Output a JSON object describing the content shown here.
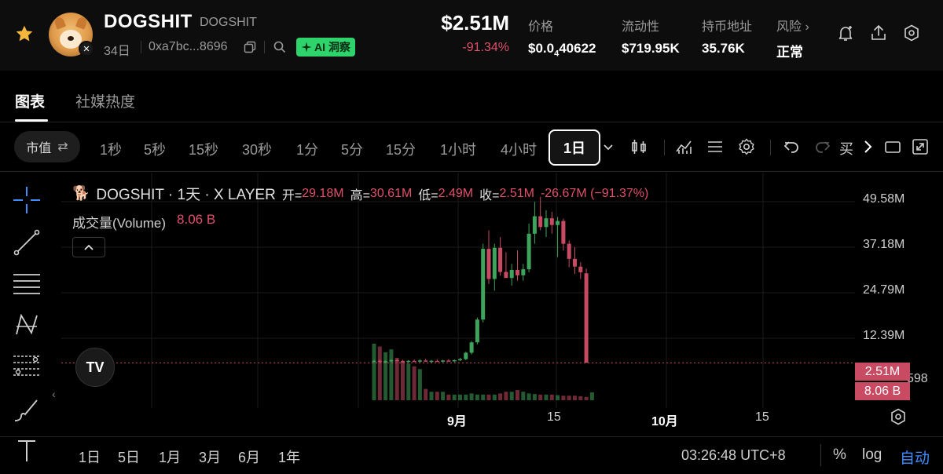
{
  "header": {
    "token_name": "DOGSHIT",
    "token_symbol": "DOGSHIT",
    "age": "34日",
    "address": "0xa7bc...8696",
    "ai_label": "AI 洞察",
    "market_cap": "$2.51M",
    "market_cap_change": "-91.34%",
    "stats": [
      {
        "label": "价格",
        "value_prefix": "$0.0",
        "value_sub": "4",
        "value_suffix": "40622"
      },
      {
        "label": "流动性",
        "value": "$719.95K"
      },
      {
        "label": "持币地址",
        "value": "35.76K"
      },
      {
        "label": "风险",
        "value": "正常"
      }
    ]
  },
  "tabs": [
    "图表",
    "社媒热度"
  ],
  "toolbar": {
    "mode_label": "市值",
    "intervals": [
      "1秒",
      "5秒",
      "15秒",
      "30秒",
      "1分",
      "5分",
      "15分",
      "1小时",
      "4小时"
    ],
    "active_interval": "1日",
    "buy_label": "买"
  },
  "legend": {
    "title": "DOGSHIT · 1天 · X LAYER",
    "open_label": "开=",
    "open": "29.18M",
    "high_label": "高=",
    "high": "30.61M",
    "low_label": "低=",
    "low": "2.49M",
    "close_label": "收=",
    "close": "2.51M",
    "change": "-26.67M (−91.37%)",
    "volume_label": "成交量(Volume)",
    "volume": "8.06 B"
  },
  "chart_data": {
    "type": "candlestick",
    "y_ticks": [
      "49.58M",
      "37.18M",
      "24.79M",
      "12.39M"
    ],
    "x_ticks": [
      "9月",
      "15",
      "10月",
      "15"
    ],
    "last_price_label": "2.51M",
    "last_volume_label": "8.06 B",
    "axis_peek": "598",
    "candles": [
      {
        "o": 2.9,
        "h": 3.4,
        "l": 2.5,
        "c": 3.1
      },
      {
        "o": 3.1,
        "h": 3.5,
        "l": 2.6,
        "c": 2.8
      },
      {
        "o": 2.8,
        "h": 3.2,
        "l": 2.4,
        "c": 3.0
      },
      {
        "o": 3.0,
        "h": 3.6,
        "l": 2.7,
        "c": 3.3
      },
      {
        "o": 3.3,
        "h": 3.7,
        "l": 2.9,
        "c": 3.0
      },
      {
        "o": 3.0,
        "h": 3.4,
        "l": 2.6,
        "c": 2.9
      },
      {
        "o": 2.9,
        "h": 3.3,
        "l": 2.5,
        "c": 3.1
      },
      {
        "o": 3.1,
        "h": 3.5,
        "l": 2.7,
        "c": 2.9
      },
      {
        "o": 2.9,
        "h": 3.6,
        "l": 2.6,
        "c": 3.2
      },
      {
        "o": 3.2,
        "h": 3.7,
        "l": 2.8,
        "c": 3.0
      },
      {
        "o": 3.0,
        "h": 3.4,
        "l": 2.6,
        "c": 3.1
      },
      {
        "o": 3.1,
        "h": 3.5,
        "l": 2.8,
        "c": 3.0
      },
      {
        "o": 3.0,
        "h": 3.4,
        "l": 2.7,
        "c": 3.2
      },
      {
        "o": 3.2,
        "h": 3.6,
        "l": 2.9,
        "c": 3.0
      },
      {
        "o": 3.0,
        "h": 3.5,
        "l": 2.7,
        "c": 3.3
      },
      {
        "o": 3.3,
        "h": 4.0,
        "l": 3.0,
        "c": 3.6
      },
      {
        "o": 3.6,
        "h": 5.8,
        "l": 3.3,
        "c": 5.5
      },
      {
        "o": 5.5,
        "h": 9.0,
        "l": 5.0,
        "c": 8.6
      },
      {
        "o": 8.6,
        "h": 16.0,
        "l": 8.0,
        "c": 15.4
      },
      {
        "o": 15.4,
        "h": 38.0,
        "l": 14.5,
        "c": 36.5
      },
      {
        "o": 36.5,
        "h": 42.0,
        "l": 26.0,
        "c": 27.5
      },
      {
        "o": 27.5,
        "h": 38.0,
        "l": 24.0,
        "c": 36.8
      },
      {
        "o": 36.8,
        "h": 40.0,
        "l": 28.5,
        "c": 29.6
      },
      {
        "o": 29.6,
        "h": 35.5,
        "l": 28.0,
        "c": 27.8
      },
      {
        "o": 27.8,
        "h": 32.0,
        "l": 25.5,
        "c": 30.2
      },
      {
        "o": 30.2,
        "h": 36.0,
        "l": 27.0,
        "c": 28.6
      },
      {
        "o": 28.6,
        "h": 32.0,
        "l": 27.0,
        "c": 30.4
      },
      {
        "o": 30.4,
        "h": 44.0,
        "l": 29.5,
        "c": 41.0
      },
      {
        "o": 41.0,
        "h": 50.5,
        "l": 38.0,
        "c": 46.2
      },
      {
        "o": 46.2,
        "h": 52.0,
        "l": 42.0,
        "c": 43.0
      },
      {
        "o": 43.0,
        "h": 48.0,
        "l": 40.0,
        "c": 45.6
      },
      {
        "o": 45.6,
        "h": 47.5,
        "l": 41.0,
        "c": 43.6
      },
      {
        "o": 43.6,
        "h": 46.0,
        "l": 34.0,
        "c": 44.8
      },
      {
        "o": 44.8,
        "h": 45.5,
        "l": 36.0,
        "c": 38.0
      },
      {
        "o": 38.0,
        "h": 39.0,
        "l": 31.0,
        "c": 33.5
      },
      {
        "o": 33.5,
        "h": 37.0,
        "l": 29.0,
        "c": 31.2
      },
      {
        "o": 31.2,
        "h": 32.5,
        "l": 27.5,
        "c": 29.5
      },
      {
        "o": 29.2,
        "h": 30.6,
        "l": 2.5,
        "c": 2.5
      }
    ],
    "volumes": [
      10,
      9.5,
      8.5,
      9,
      7.5,
      7,
      6.5,
      6,
      5.5,
      2,
      1.5,
      1.5,
      1.5,
      1,
      1,
      1,
      1,
      1.2,
      1,
      1,
      1,
      1,
      1.2,
      1.5,
      1.5,
      1.8,
      1.5,
      1.2,
      1.1,
      1,
      1,
      1,
      0.9,
      0.8,
      0.8,
      0.8,
      0.7,
      0.6,
      1.4
    ],
    "y_min": 0,
    "y_max": 55
  },
  "bottom": {
    "ranges": [
      "1日",
      "5日",
      "1月",
      "3月",
      "6月",
      "1年"
    ],
    "clock": "03:26:48 UTC+8",
    "percent": "%",
    "log": "log",
    "auto": "自动"
  },
  "colors": {
    "up": "#3fa45b",
    "down": "#c84a63",
    "accent": "#3f8cff",
    "ai_green": "#2fd36b"
  }
}
